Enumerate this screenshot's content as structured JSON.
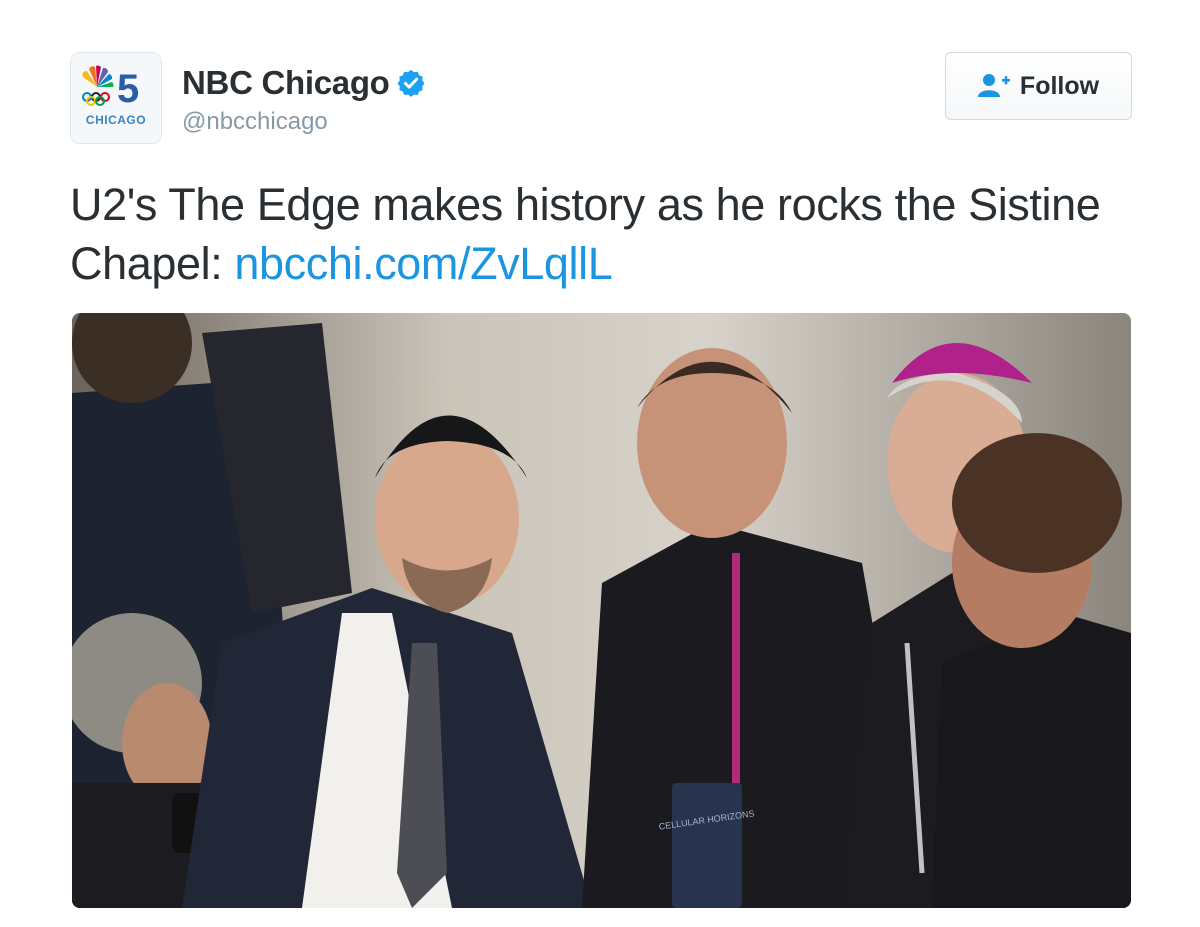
{
  "author": {
    "avatar_channel": "5",
    "avatar_city": "CHICAGO",
    "display_name": "NBC Chicago",
    "handle": "@nbcchicago",
    "verified_icon": "verified-badge-icon"
  },
  "follow_button": {
    "label": "Follow",
    "icon": "add-user-icon"
  },
  "tweet": {
    "text": "U2's The Edge makes history as he rocks the Sistine Chapel: ",
    "link_text": "nbcchi.com/ZvLqllL"
  },
  "media": {
    "badge_text": "CELLULAR HORIZONS"
  },
  "colors": {
    "link": "#1b95e0",
    "verified": "#1da1f2",
    "text": "#292f33",
    "muted": "#8899a6"
  }
}
